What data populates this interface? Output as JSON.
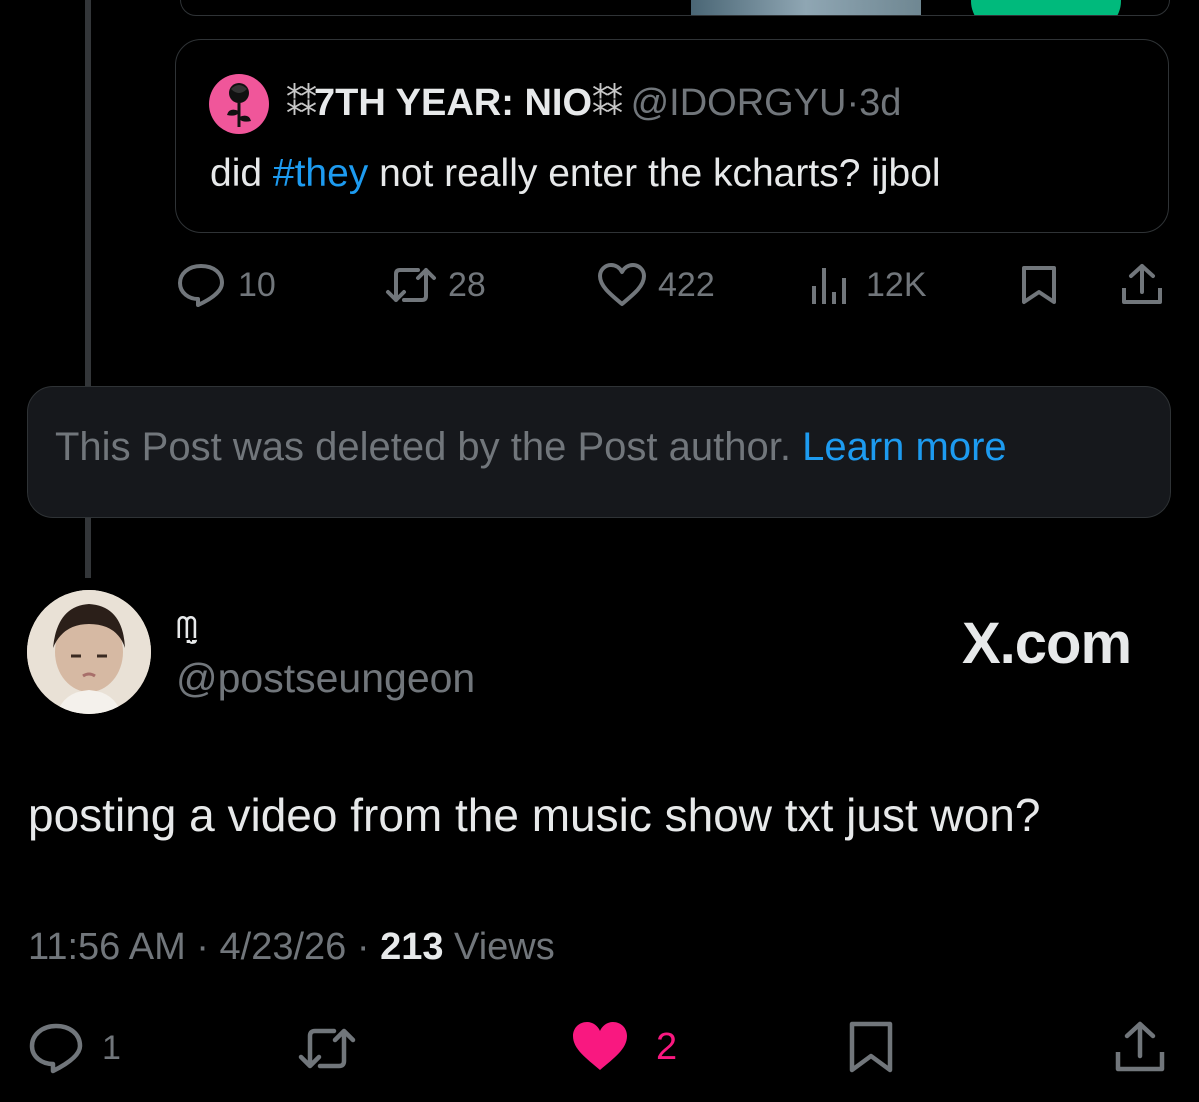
{
  "quoted_post": {
    "display_name": "7TH YEAR: NIO",
    "name_decoration_left": "⁑⁑",
    "name_decoration_right": "⁑⁑",
    "handle": "@IDORGYU",
    "time_sep": "·",
    "time": "3d",
    "text_before": "did ",
    "hashtag": "#they",
    "text_after": " not really enter the kcharts? ijbol"
  },
  "quoted_actions": {
    "replies": "10",
    "reposts": "28",
    "likes": "422",
    "views": "12K"
  },
  "deleted_notice": {
    "text": "This Post was deleted by the Post author.",
    "link": "Learn more"
  },
  "main_post": {
    "display_name": "ᗰ̤̮",
    "handle": "@postseungeon",
    "watermark": "X.com",
    "text": "posting a video from the music show txt just won?",
    "time": "11:56 AM",
    "sep1": " · ",
    "date": "4/23/26",
    "sep2": " · ",
    "views_count": "213",
    "views_label": " Views"
  },
  "main_actions": {
    "replies": "1",
    "likes": "2"
  },
  "colors": {
    "background": "#000000",
    "link": "#1d9bf0",
    "muted": "#71767b",
    "like": "#f91880",
    "rose_avatar": "#f0569a"
  }
}
